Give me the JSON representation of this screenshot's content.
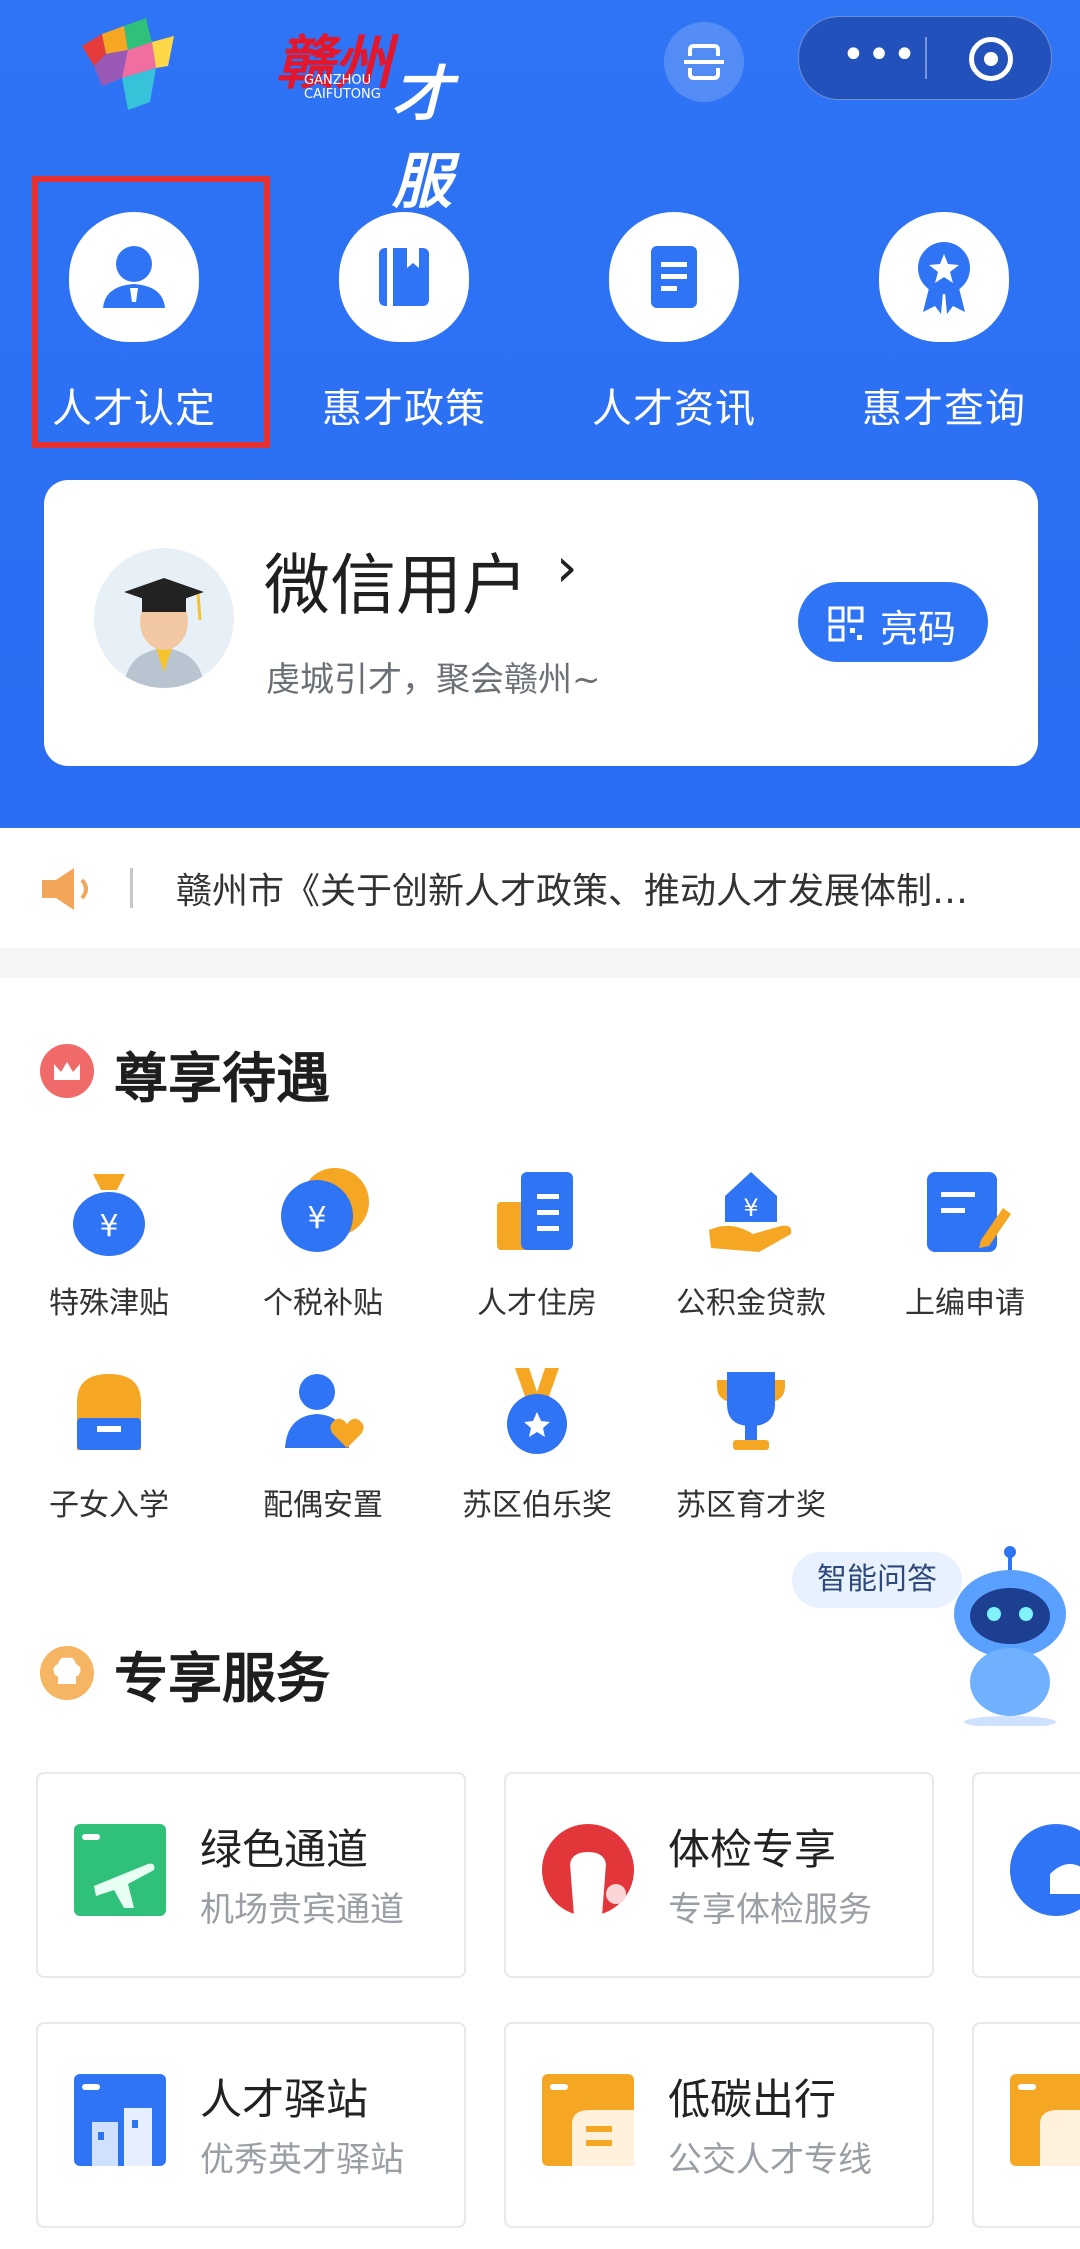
{
  "header": {
    "logo_city": "赣州",
    "logo_pinyin": "GANZHOU CAIFUTONG",
    "logo_brand": "才服通",
    "capsule_more": "•••"
  },
  "quick_entries": [
    {
      "label": "人才认定",
      "icon": "person-icon"
    },
    {
      "label": "惠才政策",
      "icon": "book-icon"
    },
    {
      "label": "人才资讯",
      "icon": "document-icon"
    },
    {
      "label": "惠才查询",
      "icon": "medal-icon"
    }
  ],
  "user_card": {
    "name": "微信用户",
    "arrow": "›",
    "tagline": "虔城引才，聚会赣州~",
    "qr_button": "亮码"
  },
  "notice": {
    "text": "赣州市《关于创新人才政策、推动人才发展体制…"
  },
  "section_benefits": {
    "title": "尊享待遇",
    "items": [
      {
        "label": "特殊津贴",
        "icon": "money-bag-icon"
      },
      {
        "label": "个税补贴",
        "icon": "coin-icon"
      },
      {
        "label": "人才住房",
        "icon": "building-icon"
      },
      {
        "label": "公积金贷款",
        "icon": "house-hand-icon"
      },
      {
        "label": "上编申请",
        "icon": "edit-form-icon"
      },
      {
        "label": "子女入学",
        "icon": "backpack-icon"
      },
      {
        "label": "配偶安置",
        "icon": "person-heart-icon"
      },
      {
        "label": "苏区伯乐奖",
        "icon": "medal-icon"
      },
      {
        "label": "苏区育才奖",
        "icon": "trophy-icon"
      }
    ]
  },
  "ai_assistant": {
    "label": "智能问答"
  },
  "section_services": {
    "title": "专享服务",
    "cards": [
      {
        "title": "绿色通道",
        "subtitle": "机场贵宾通道",
        "icon": "plane-icon",
        "color": "#2fc07a"
      },
      {
        "title": "体检专享",
        "subtitle": "专享体检服务",
        "icon": "health-icon",
        "color": "#e2363a"
      },
      {
        "title": "人才驿站",
        "subtitle": "优秀英才驿站",
        "icon": "station-icon",
        "color": "#2f74f5"
      },
      {
        "title": "低碳出行",
        "subtitle": "公交人才专线",
        "icon": "bus-icon",
        "color": "#f5a623"
      }
    ]
  },
  "colors": {
    "primary": "#2f74f5",
    "highlight": "#e53030"
  }
}
